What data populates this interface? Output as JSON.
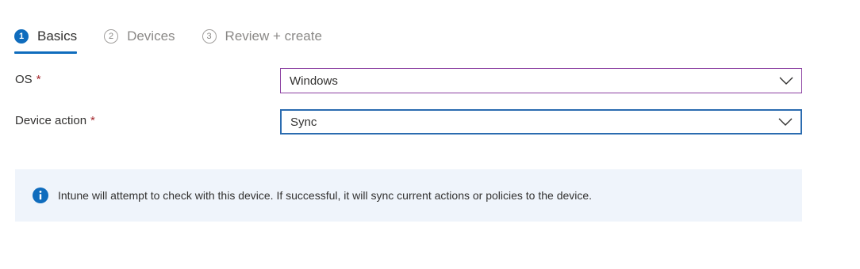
{
  "wizard": {
    "steps": [
      {
        "number": "1",
        "label": "Basics",
        "state": "active"
      },
      {
        "number": "2",
        "label": "Devices",
        "state": "inactive"
      },
      {
        "number": "3",
        "label": "Review + create",
        "state": "inactive"
      }
    ]
  },
  "form": {
    "os": {
      "label": "OS",
      "required_mark": "*",
      "value": "Windows"
    },
    "device_action": {
      "label": "Device action",
      "required_mark": "*",
      "value": "Sync"
    }
  },
  "info": {
    "icon": "info-icon",
    "text": "Intune will attempt to check with this device. If successful, it will sync current actions or policies to the device."
  },
  "colors": {
    "accent": "#0f6cbd",
    "required": "#a4262c",
    "info_background": "#eff4fb",
    "os_dropdown_border": "#8a3ea0",
    "action_dropdown_border": "#2b6cb0"
  }
}
